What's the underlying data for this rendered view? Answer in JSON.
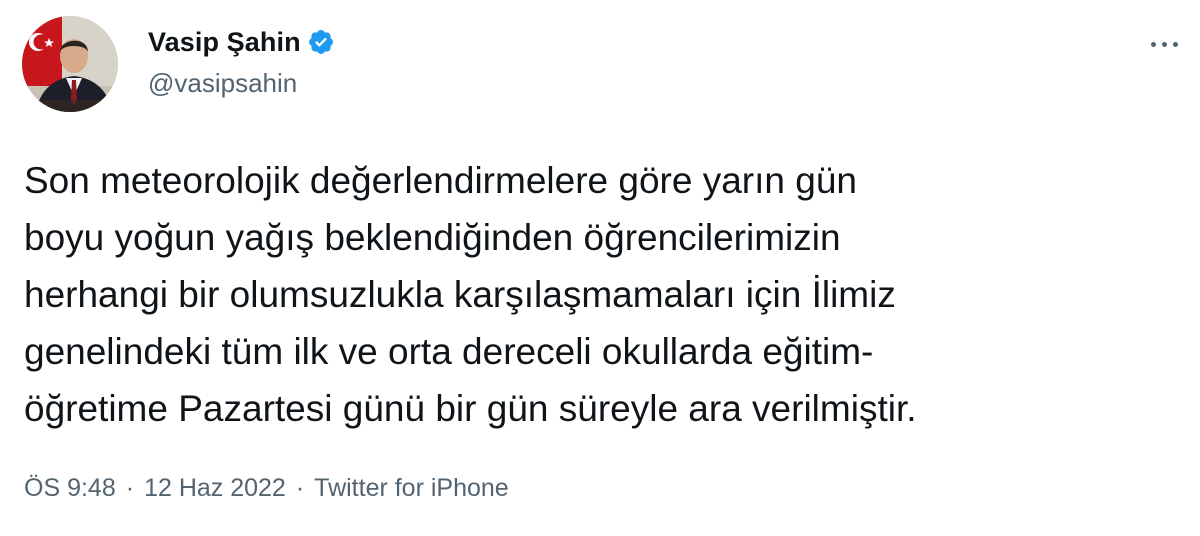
{
  "author": {
    "display_name": "Vasip Şahin",
    "handle": "@vasipsahin",
    "verified": true
  },
  "tweet": {
    "text": "Son meteorolojik değerlendirmelere göre yarın gün\nboyu yoğun yağış beklendiğinden öğrencilerimizin\nherhangi bir olumsuzlukla karşılaşmamaları için İlimiz\ngenelindeki tüm ilk ve orta dereceli okullarda eğitim-\nöğretime Pazartesi günü bir gün süreyle ara verilmiştir."
  },
  "meta": {
    "time": "ÖS 9:48",
    "separator": "·",
    "date": "12 Haz 2022",
    "source": "Twitter for iPhone"
  },
  "icons": {
    "verified": "verified-badge-icon",
    "more": "more-options-icon"
  },
  "colors": {
    "text": "#0f1419",
    "secondary": "#536471",
    "verified_blue": "#1d9bf0"
  }
}
